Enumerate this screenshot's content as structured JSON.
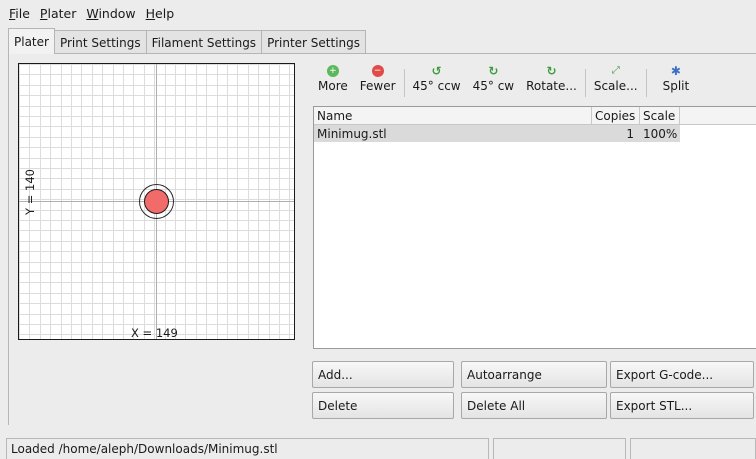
{
  "menubar": {
    "items": [
      {
        "key": "F",
        "rest": "ile"
      },
      {
        "key": "P",
        "rest": "later"
      },
      {
        "key": "W",
        "rest": "indow"
      },
      {
        "key": "H",
        "rest": "elp"
      }
    ]
  },
  "tabs": [
    "Plater",
    "Print Settings",
    "Filament Settings",
    "Printer Settings"
  ],
  "active_tab": "Plater",
  "bed": {
    "x_label": "X = 149",
    "y_label": "Y = 140",
    "object_color": "#f26b6b",
    "grid_color": "#dcdcdc",
    "axis_color": "#b0b0b0"
  },
  "toolbar": {
    "buttons": [
      {
        "label": "More",
        "icon": "plus-circle-icon"
      },
      {
        "label": "Fewer",
        "icon": "minus-circle-icon"
      },
      {
        "label": "45° ccw",
        "icon": "rotate-ccw-icon"
      },
      {
        "label": "45° cw",
        "icon": "rotate-cw-icon"
      },
      {
        "label": "Rotate...",
        "icon": "rotate-icon"
      },
      {
        "label": "Scale...",
        "icon": "scale-icon"
      },
      {
        "label": "Split",
        "icon": "split-icon"
      }
    ]
  },
  "object_list": {
    "columns": [
      "Name",
      "Copies",
      "Scale"
    ],
    "rows": [
      {
        "name": "Minimug.stl",
        "copies": "1",
        "scale": "100%"
      }
    ]
  },
  "actions": {
    "add": "Add...",
    "autoarrange": "Autoarrange",
    "export_gcode": "Export G-code...",
    "delete": "Delete",
    "delete_all": "Delete All",
    "export_stl": "Export STL..."
  },
  "status": {
    "message": "Loaded /home/aleph/Downloads/Minimug.stl"
  }
}
